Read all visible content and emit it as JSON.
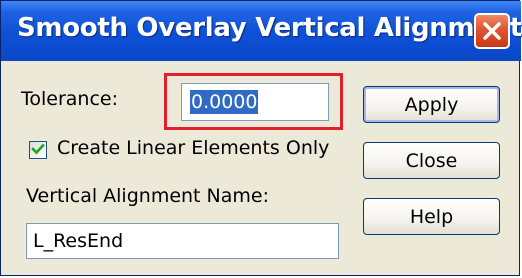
{
  "dialog": {
    "title": "Smooth Overlay Vertical Alignment",
    "tolerance_label": "Tolerance:",
    "tolerance_value": "0.0000",
    "checkbox_label": "Create Linear Elements Only",
    "checkbox_checked": true,
    "name_label": "Vertical Alignment Name:",
    "name_value": "L_ResEnd"
  },
  "buttons": {
    "apply": "Apply",
    "close": "Close",
    "help": "Help"
  },
  "icons": {
    "close": "close-icon",
    "check": "checkmark-icon"
  },
  "colors": {
    "title_bar": "#0f52d8",
    "close_button": "#e0542f",
    "highlight": "#e0202a",
    "checkmark": "#21a121",
    "selection": "#316ac5"
  }
}
